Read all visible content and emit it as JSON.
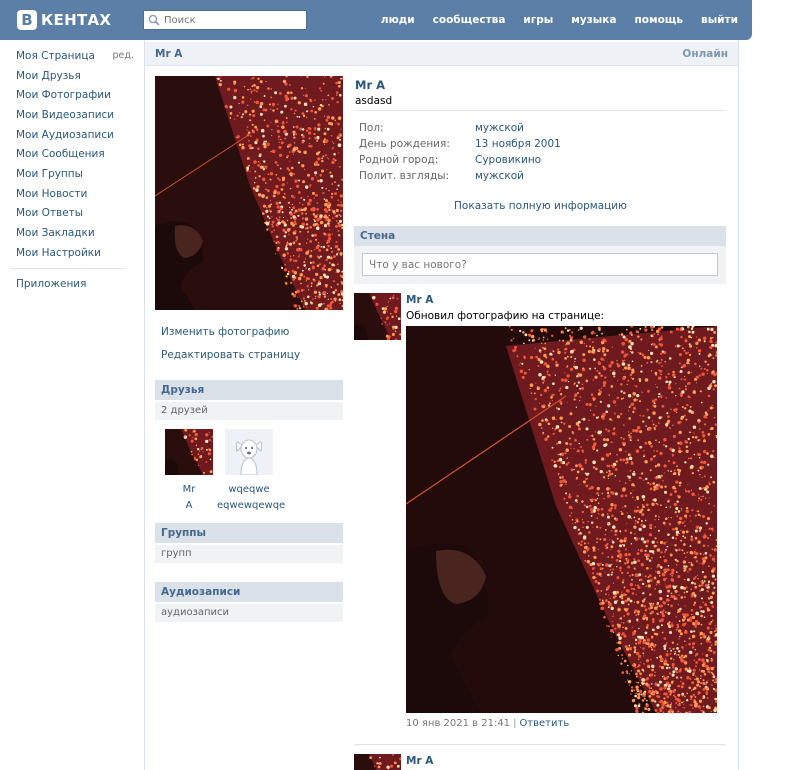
{
  "header": {
    "logo_letter": "В",
    "logo_text": "КЕНТАХ",
    "search_placeholder": "Поиск",
    "nav": [
      "люди",
      "сообщества",
      "игры",
      "музыка",
      "помощь",
      "выйти"
    ],
    "bg_color": "#5b7fa6"
  },
  "sidebar": {
    "edit_label": "ред.",
    "items": [
      "Моя Страница",
      "Мои Друзья",
      "Мои Фотографии",
      "Мои Видеозаписи",
      "Мои Аудиозаписи",
      "Мои Сообщения",
      "Мои Группы",
      "Мои Новости",
      "Мои Ответы",
      "Мои Закладки",
      "Мои Настройки"
    ],
    "apps": "Приложения"
  },
  "profile": {
    "header_name": "Mr A",
    "online": "Онлайн",
    "name": "Mr A",
    "status": "asdasd",
    "info": [
      {
        "label": "Пол:",
        "value": "мужской"
      },
      {
        "label": "День рождения:",
        "value": "13 ноября 2001"
      },
      {
        "label": "Родной город:",
        "value": "Суровикино"
      },
      {
        "label": "Полит. взгляды:",
        "value": "мужской"
      }
    ],
    "show_full": "Показать полную информацию",
    "change_photo": "Изменить фотографию",
    "edit_page": "Редактировать страницу"
  },
  "friends": {
    "title": "Друзья",
    "count": "2 друзей",
    "items": [
      {
        "name_line1": "Mr",
        "name_line2": "A"
      },
      {
        "name_line1": "wqeqwe",
        "name_line2": "eqwewqewqe"
      }
    ]
  },
  "groups": {
    "title": "Группы",
    "sub": "групп"
  },
  "audio": {
    "title": "Аудиозаписи",
    "sub": "аудиозаписи"
  },
  "wall": {
    "title": "Стена",
    "placeholder": "Что у вас нового?",
    "post": {
      "author": "Mr A",
      "text": "Обновил фотографию на странице:",
      "date": "10 янв 2021 в 21:41",
      "sep": "|",
      "reply": "Ответить"
    },
    "next_author": "Mr A"
  }
}
